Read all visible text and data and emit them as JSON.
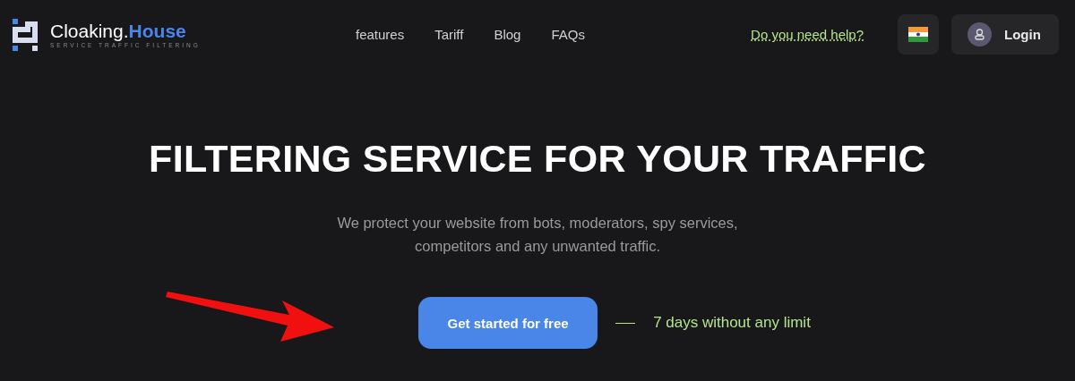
{
  "logo": {
    "name": "Cloaking.",
    "accent": "House",
    "tagline": "SERVICE TRAFFIC FILTERING"
  },
  "nav": [
    {
      "label": "features"
    },
    {
      "label": "Tariff"
    },
    {
      "label": "Blog"
    },
    {
      "label": "FAQs"
    }
  ],
  "help_link": "Do you need help?",
  "login": {
    "label": "Login"
  },
  "hero": {
    "title": "FILTERING SERVICE FOR YOUR TRAFFIC",
    "subtitle": "We protect your website from bots, moderators, spy services, competitors and any unwanted traffic.",
    "cta": "Get started for free",
    "note": "7 days without any limit"
  }
}
